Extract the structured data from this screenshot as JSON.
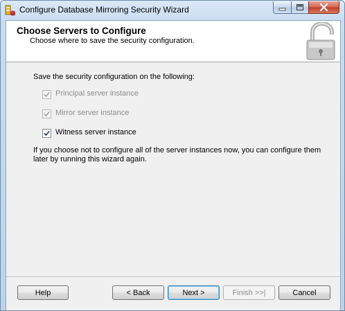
{
  "window": {
    "title": "Configure Database Mirroring Security Wizard"
  },
  "header": {
    "title": "Choose Servers to Configure",
    "subtitle": "Choose where to save the security configuration."
  },
  "main": {
    "prompt": "Save the security configuration on the following:",
    "options": [
      {
        "label": "Principal server instance",
        "checked": true,
        "enabled": false
      },
      {
        "label": "Mirror server instance",
        "checked": true,
        "enabled": false
      },
      {
        "label": "Witness server instance",
        "checked": true,
        "enabled": true
      }
    ],
    "note": "If you choose not to configure all of the server instances now, you can configure them later by running this wizard again."
  },
  "buttons": {
    "help": "Help",
    "back": "< Back",
    "next": "Next >",
    "finish": "Finish >>|",
    "cancel": "Cancel"
  },
  "icons": {
    "app": "database-server-icon",
    "header": "open-padlock-icon",
    "minimize": "minimize-icon",
    "maximize": "maximize-icon",
    "close": "close-icon",
    "check": "checkmark-icon"
  }
}
